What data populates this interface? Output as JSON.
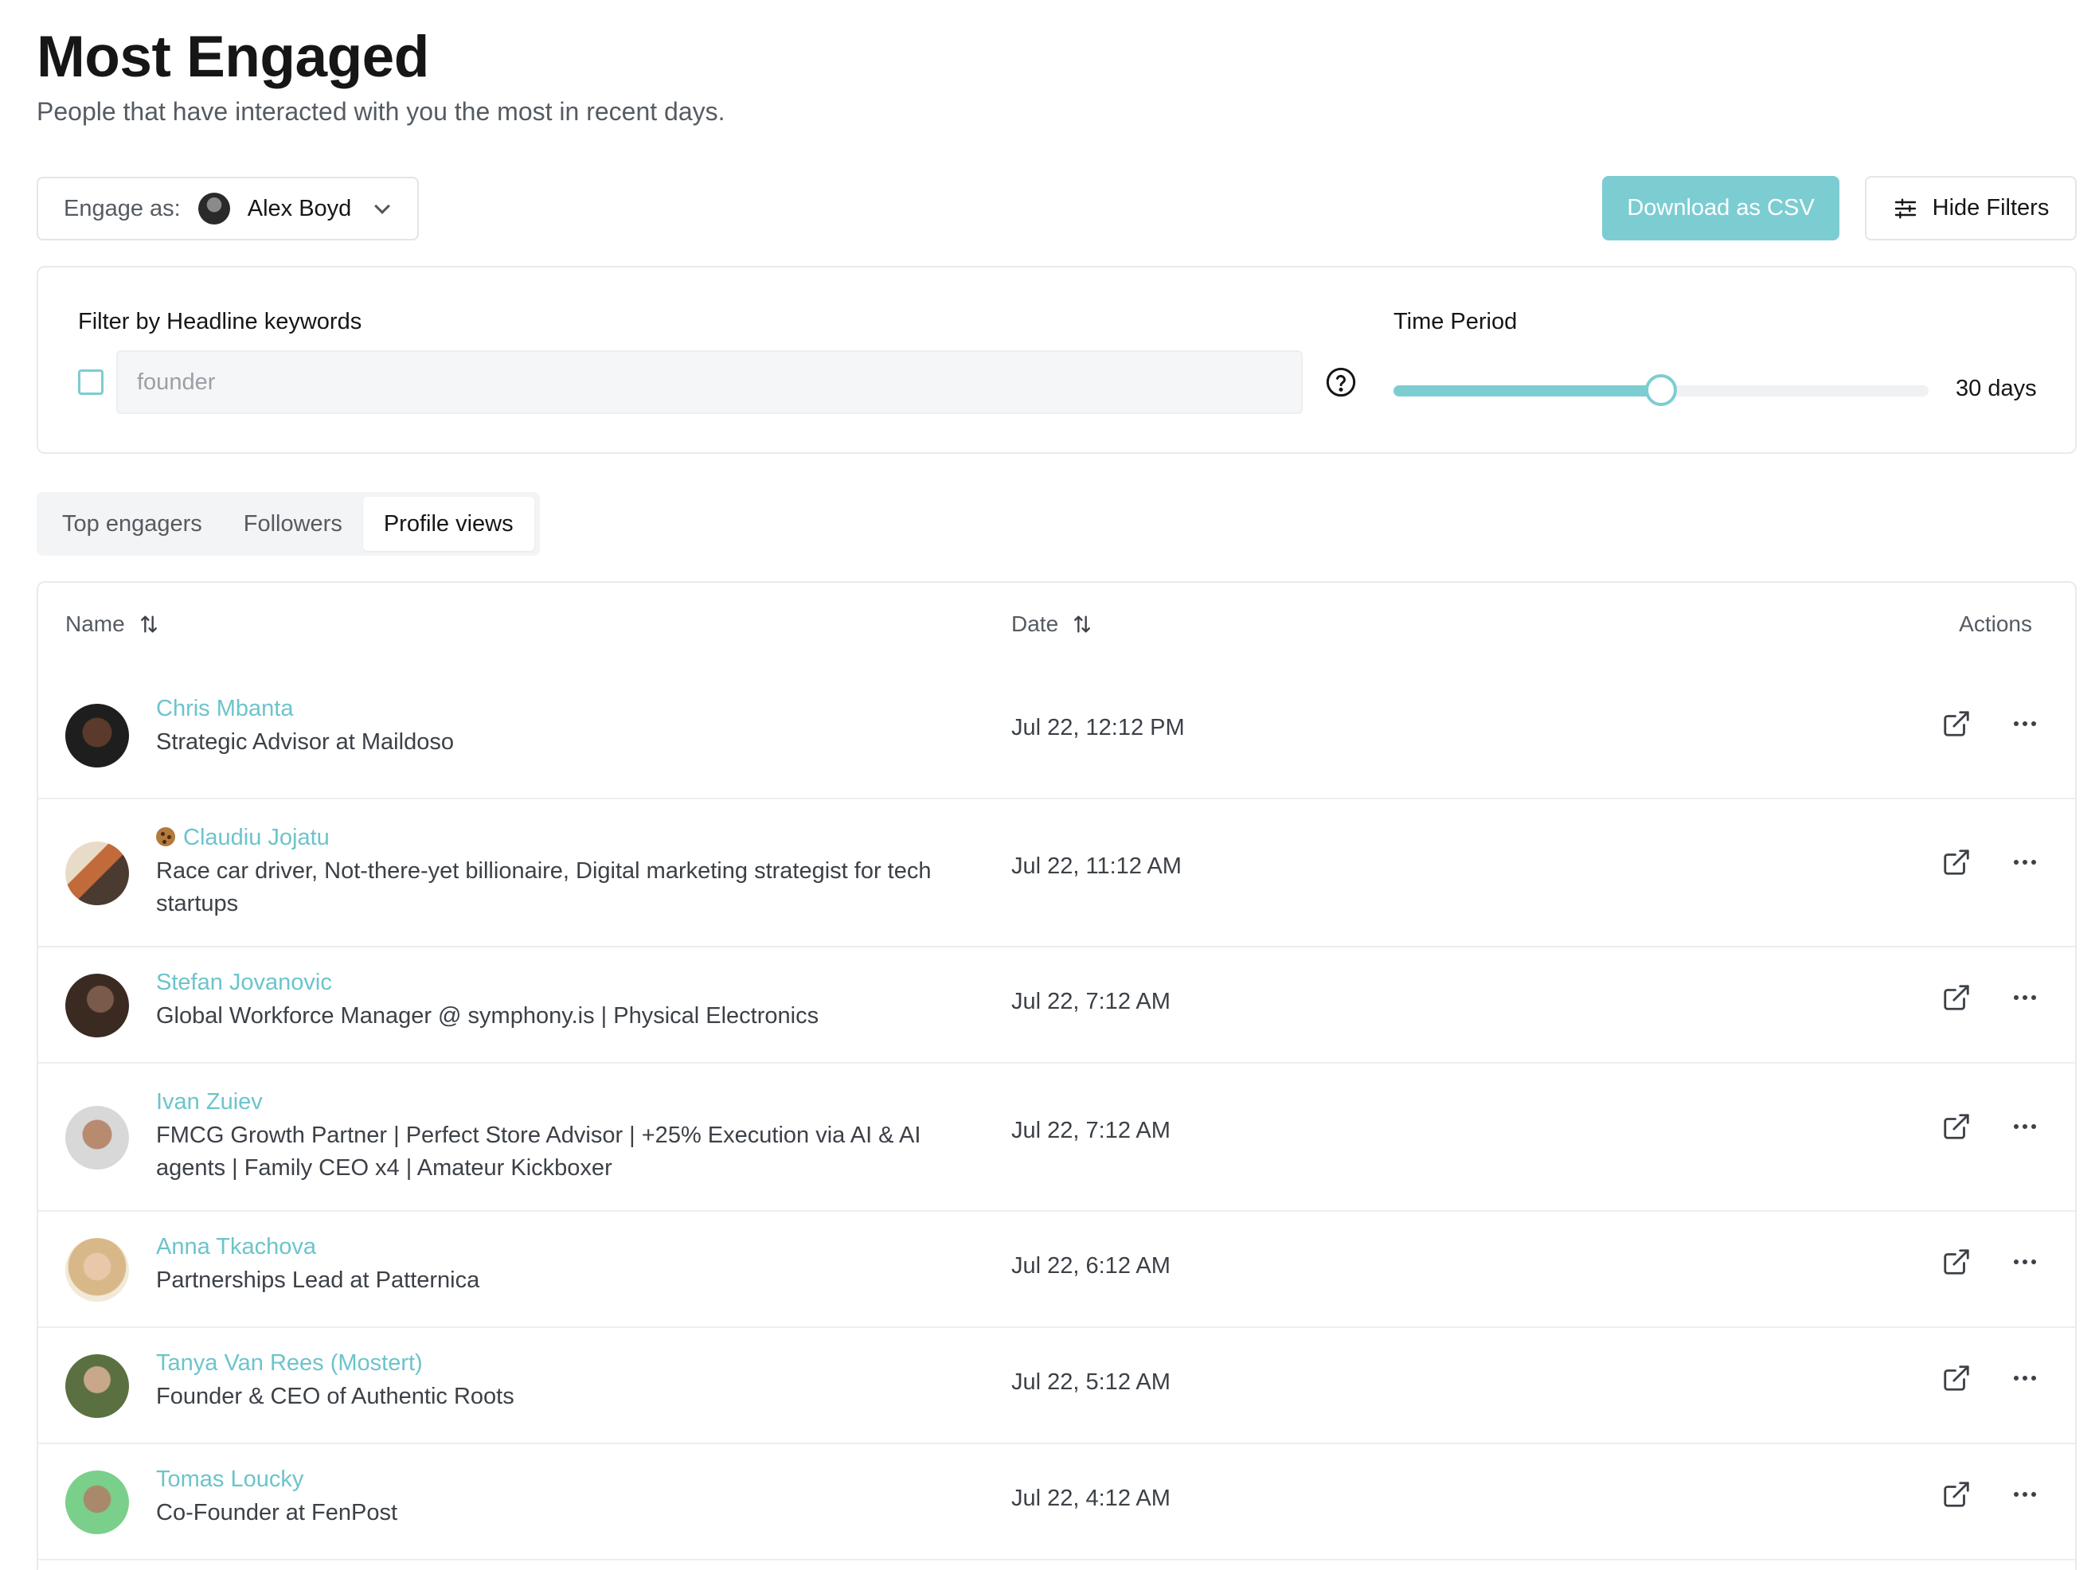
{
  "page": {
    "title": "Most Engaged",
    "subtitle": "People that have interacted with you the most in recent days."
  },
  "toolbar": {
    "engage_label": "Engage as:",
    "engage_user": "Alex Boyd",
    "download_label": "Download as CSV",
    "hide_filters_label": "Hide Filters",
    "accent_color": "#7ccdd2"
  },
  "filters": {
    "keyword_label": "Filter by Headline keywords",
    "keyword_checked": false,
    "keyword_placeholder": "founder",
    "period_label": "Time Period",
    "period_value": "30 days",
    "period_slider_fraction": 0.5
  },
  "tabs": [
    {
      "label": "Top engagers",
      "active": false
    },
    {
      "label": "Followers",
      "active": false
    },
    {
      "label": "Profile views",
      "active": true
    }
  ],
  "table": {
    "columns": {
      "name": "Name",
      "date": "Date",
      "actions": "Actions"
    },
    "rows": [
      {
        "name": "Chris Mbanta",
        "headline": "Strategic Advisor at Maildoso",
        "date": "Jul 22, 12:12 PM",
        "emoji": false
      },
      {
        "name": "Claudiu Jojatu",
        "headline": "Race car driver, Not-there-yet billionaire, Digital marketing strategist for tech startups",
        "date": "Jul 22, 11:12 AM",
        "emoji": true
      },
      {
        "name": "Stefan Jovanovic",
        "headline": "Global Workforce Manager @ symphony.is | Physical Electronics",
        "date": "Jul 22, 7:12 AM",
        "emoji": false
      },
      {
        "name": "Ivan Zuiev",
        "headline": "FMCG Growth Partner | Perfect Store Advisor | +25% Execution via AI & AI agents | Family CEO x4 | Amateur Kickboxer",
        "date": "Jul 22, 7:12 AM",
        "emoji": false
      },
      {
        "name": "Anna Tkachova",
        "headline": "Partnerships Lead at Patternica",
        "date": "Jul 22, 6:12 AM",
        "emoji": false
      },
      {
        "name": "Tanya Van Rees (Mostert)",
        "headline": "Founder & CEO of Authentic Roots",
        "date": "Jul 22, 5:12 AM",
        "emoji": false
      },
      {
        "name": "Tomas Loucky",
        "headline": "Co-Founder at FenPost",
        "date": "Jul 22, 4:12 AM",
        "emoji": false
      }
    ]
  }
}
